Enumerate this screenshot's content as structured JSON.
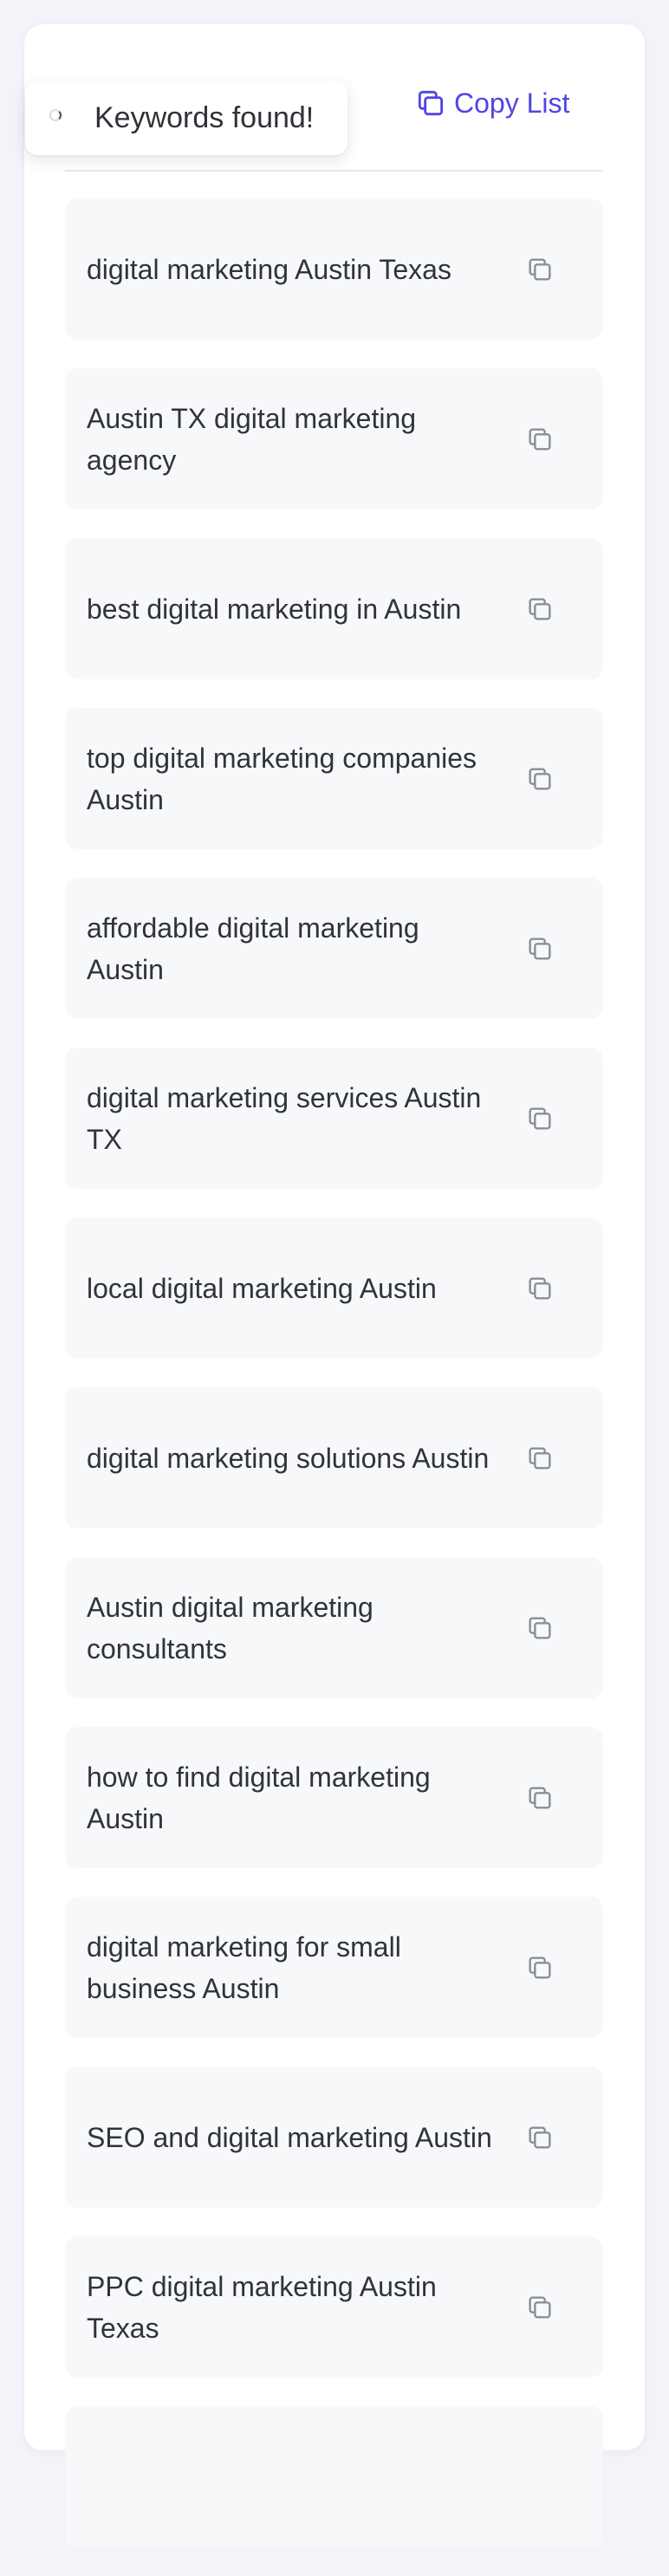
{
  "toast": {
    "message": "Keywords found!"
  },
  "header": {
    "copy_list_label": "Copy List",
    "copy_list_icon": "copy-icon",
    "accent_color": "#4f46e5"
  },
  "keywords": [
    {
      "text": "digital marketing Austin Texas"
    },
    {
      "text": "Austin TX digital marketing agency"
    },
    {
      "text": "best digital marketing in Austin"
    },
    {
      "text": "top digital marketing companies Austin"
    },
    {
      "text": "affordable digital marketing Austin"
    },
    {
      "text": "digital marketing services Austin TX"
    },
    {
      "text": "local digital marketing Austin"
    },
    {
      "text": "digital marketing solutions Austin"
    },
    {
      "text": "Austin digital marketing consultants"
    },
    {
      "text": "how to find digital marketing Austin"
    },
    {
      "text": "digital marketing for small business Austin"
    },
    {
      "text": "SEO and digital marketing Austin"
    },
    {
      "text": "PPC digital marketing Austin Texas"
    },
    {
      "text": ""
    }
  ]
}
